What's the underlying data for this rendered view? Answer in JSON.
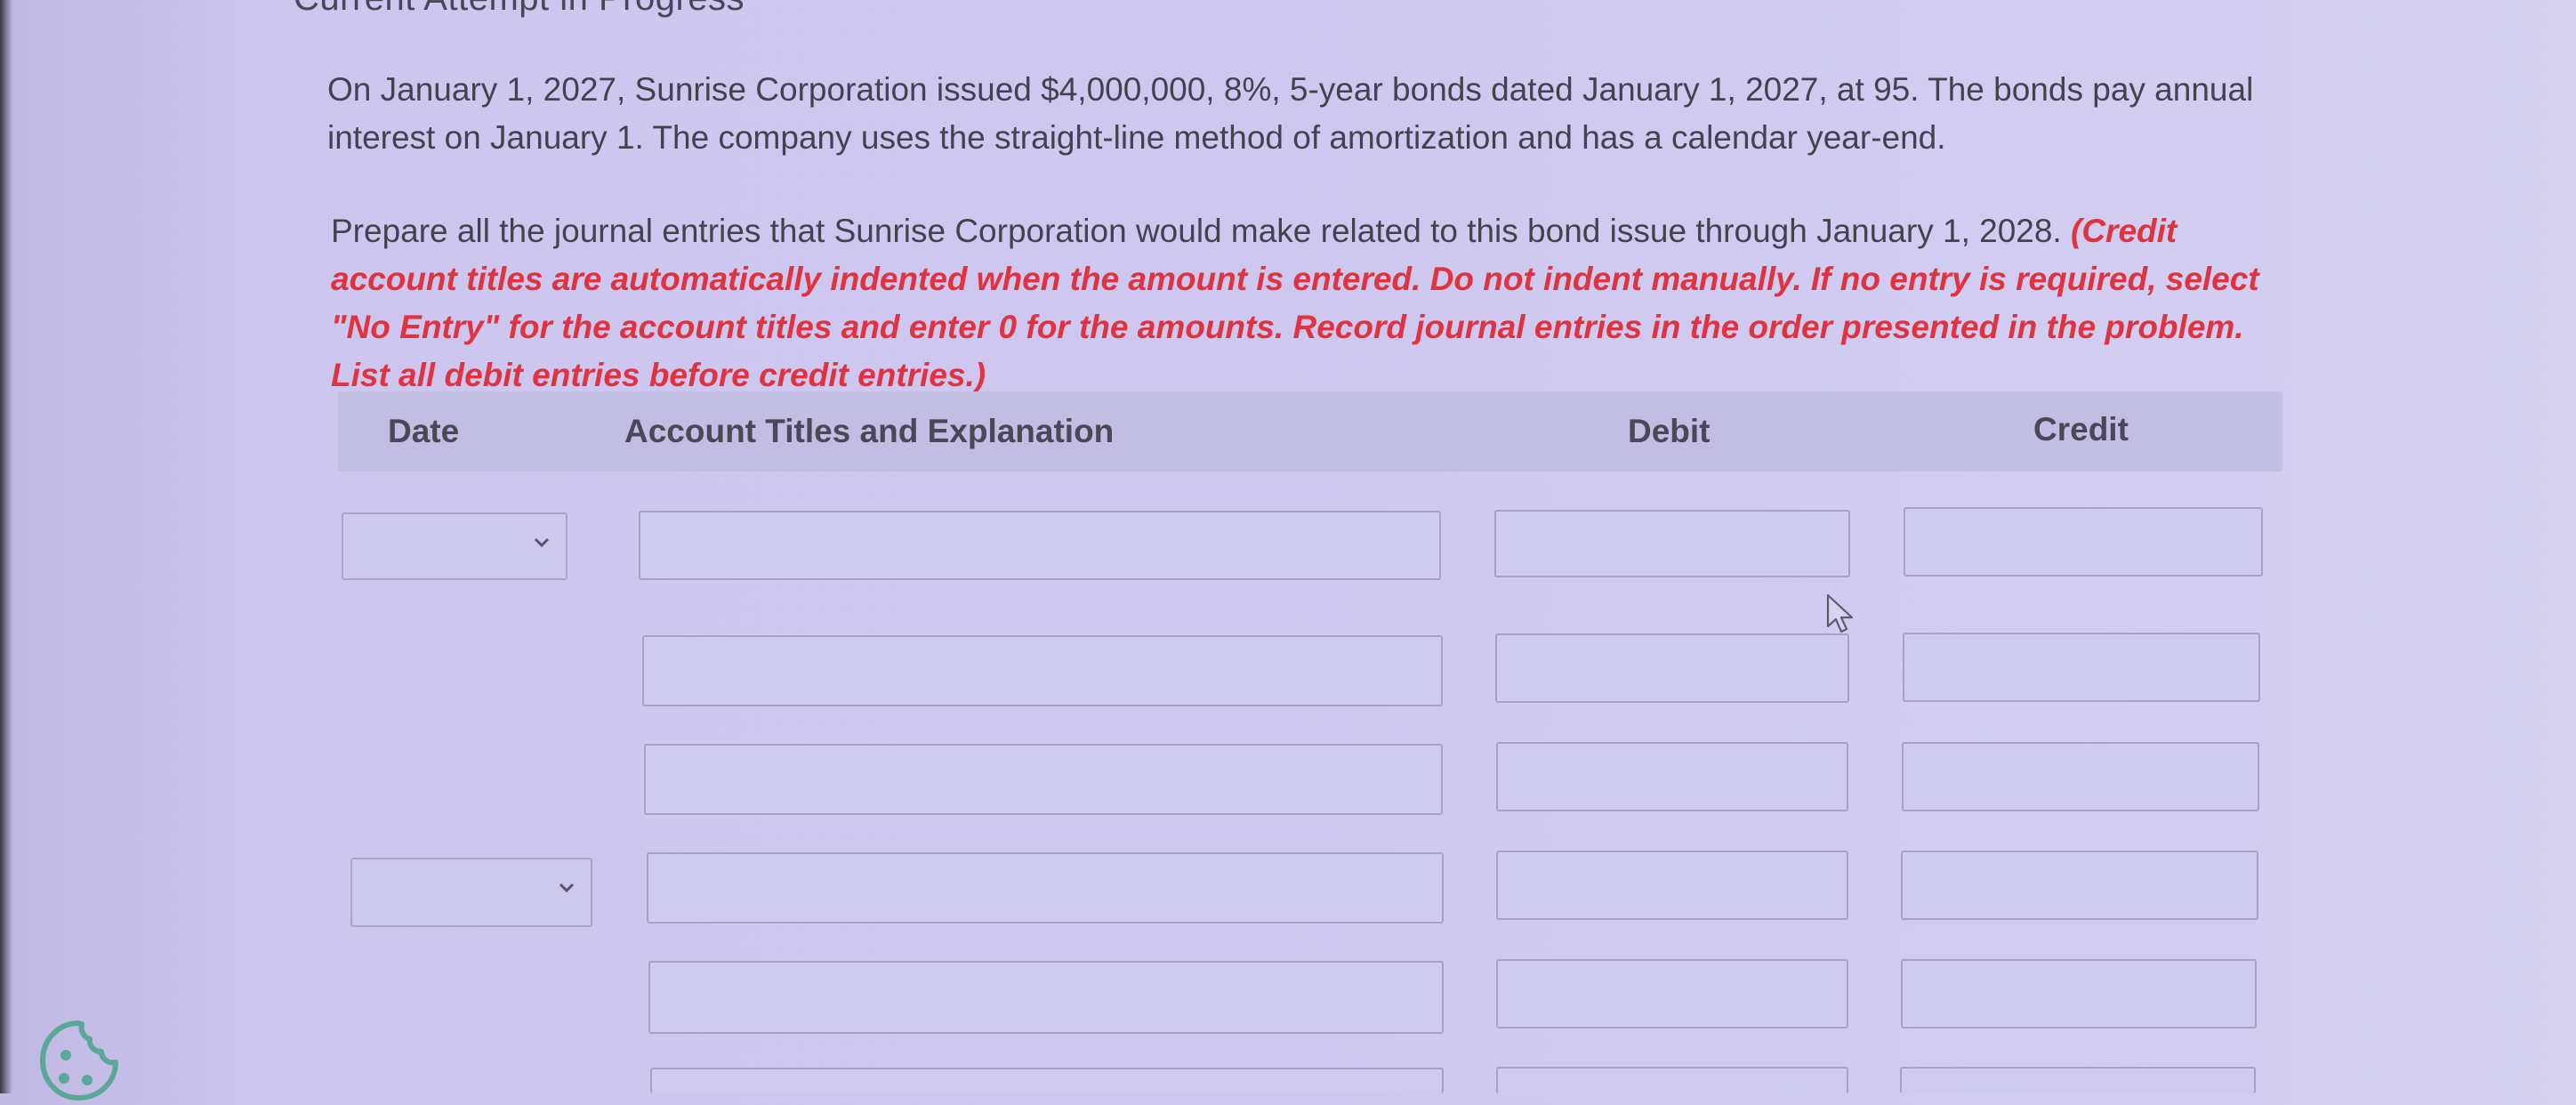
{
  "page": {
    "heading": "Current Attempt in Progress"
  },
  "problem": {
    "text": "On January 1, 2027, Sunrise Corporation issued $4,000,000, 8%, 5-year bonds dated January 1, 2027, at 95. The bonds pay annual interest on January 1. The company uses the straight-line method of amortization and has a calendar year-end."
  },
  "instructions": {
    "text": "Prepare all the journal entries that Sunrise Corporation would make related to this bond issue through January 1, 2028.",
    "note": "(Credit account titles are automatically indented when the amount is entered. Do not indent manually. If no entry is required, select \"No Entry\" for the account titles and enter 0 for the amounts. Record journal entries in the order presented in the problem. List all debit entries before credit entries.)"
  },
  "table": {
    "headers": {
      "date": "Date",
      "account": "Account Titles and Explanation",
      "debit": "Debit",
      "credit": "Credit"
    },
    "rows": [
      {
        "date": "",
        "account": "",
        "debit": "",
        "credit": ""
      },
      {
        "account": "",
        "debit": "",
        "credit": ""
      },
      {
        "account": "",
        "debit": "",
        "credit": ""
      },
      {
        "date": "",
        "account": "",
        "debit": "",
        "credit": ""
      },
      {
        "account": "",
        "debit": "",
        "credit": ""
      },
      {
        "account": "",
        "debit": "",
        "credit": ""
      }
    ]
  },
  "icons": {
    "dropdown": "chevron-down-icon",
    "cursor": "mouse-pointer-icon",
    "cookie": "cookie-settings-icon"
  },
  "colors": {
    "accent_red": "#e0323f",
    "header_bg": "#c2bde2",
    "input_border": "#a7a2c4"
  }
}
